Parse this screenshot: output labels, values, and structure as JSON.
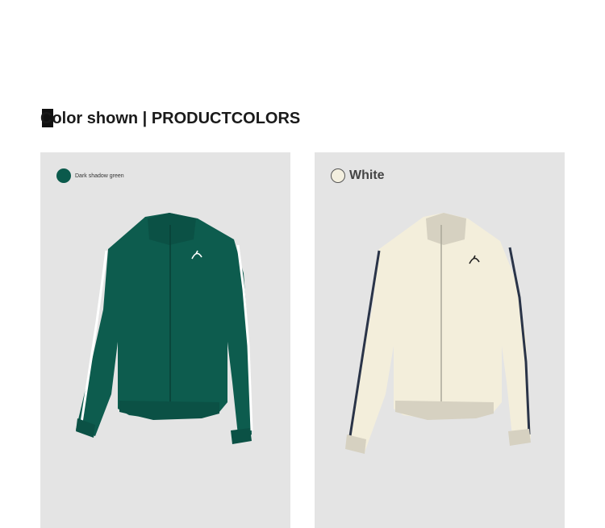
{
  "header": {
    "title": "Color shown | PRODUCTCOLORS"
  },
  "products": [
    {
      "color_name": "Dark shadow green",
      "swatch_color": "#0b5a4c",
      "jacket_color": "#0d5c4e",
      "stripe_color": "#ffffff",
      "icon": "jacket-icon"
    },
    {
      "color_name": "White",
      "swatch_color": "#f3efdf",
      "jacket_color": "#f3eedb",
      "stripe_color": "#2a3448",
      "icon": "jacket-icon"
    }
  ]
}
